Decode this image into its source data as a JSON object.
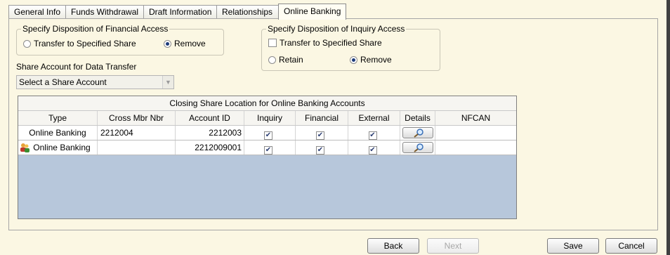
{
  "tabs": [
    {
      "label": "General Info"
    },
    {
      "label": "Funds Withdrawal"
    },
    {
      "label": "Draft Information"
    },
    {
      "label": "Relationships"
    },
    {
      "label": "Online Banking"
    }
  ],
  "financial_group": {
    "title": "Specify Disposition of Financial Access",
    "option_transfer": "Transfer to Specified Share",
    "option_remove": "Remove",
    "selected": "Remove"
  },
  "inquiry_group": {
    "title": "Specify Disposition of Inquiry Access",
    "transfer_checkbox": "Transfer to Specified Share",
    "option_retain": "Retain",
    "option_remove": "Remove",
    "selected": "Remove"
  },
  "share_account": {
    "label": "Share Account for Data Transfer",
    "selected_value": "Select a Share Account"
  },
  "grid": {
    "caption": "Closing Share Location for Online Banking Accounts",
    "columns": [
      "Type",
      "Cross Mbr Nbr",
      "Account ID",
      "Inquiry",
      "Financial",
      "External",
      "Details",
      "NFCAN"
    ],
    "rows": [
      {
        "type": "Online Banking",
        "cross_mbr_nbr": "2212004",
        "account_id": "2212003",
        "inquiry": true,
        "financial": true,
        "external": true,
        "nfcan": "",
        "icon": "none"
      },
      {
        "type": "Online Banking",
        "cross_mbr_nbr": "",
        "account_id": "2212009001",
        "inquiry": true,
        "financial": true,
        "external": true,
        "nfcan": "",
        "icon": "users-icon"
      }
    ]
  },
  "buttons": {
    "back": "Back",
    "next": "Next",
    "save": "Save",
    "cancel": "Cancel"
  }
}
